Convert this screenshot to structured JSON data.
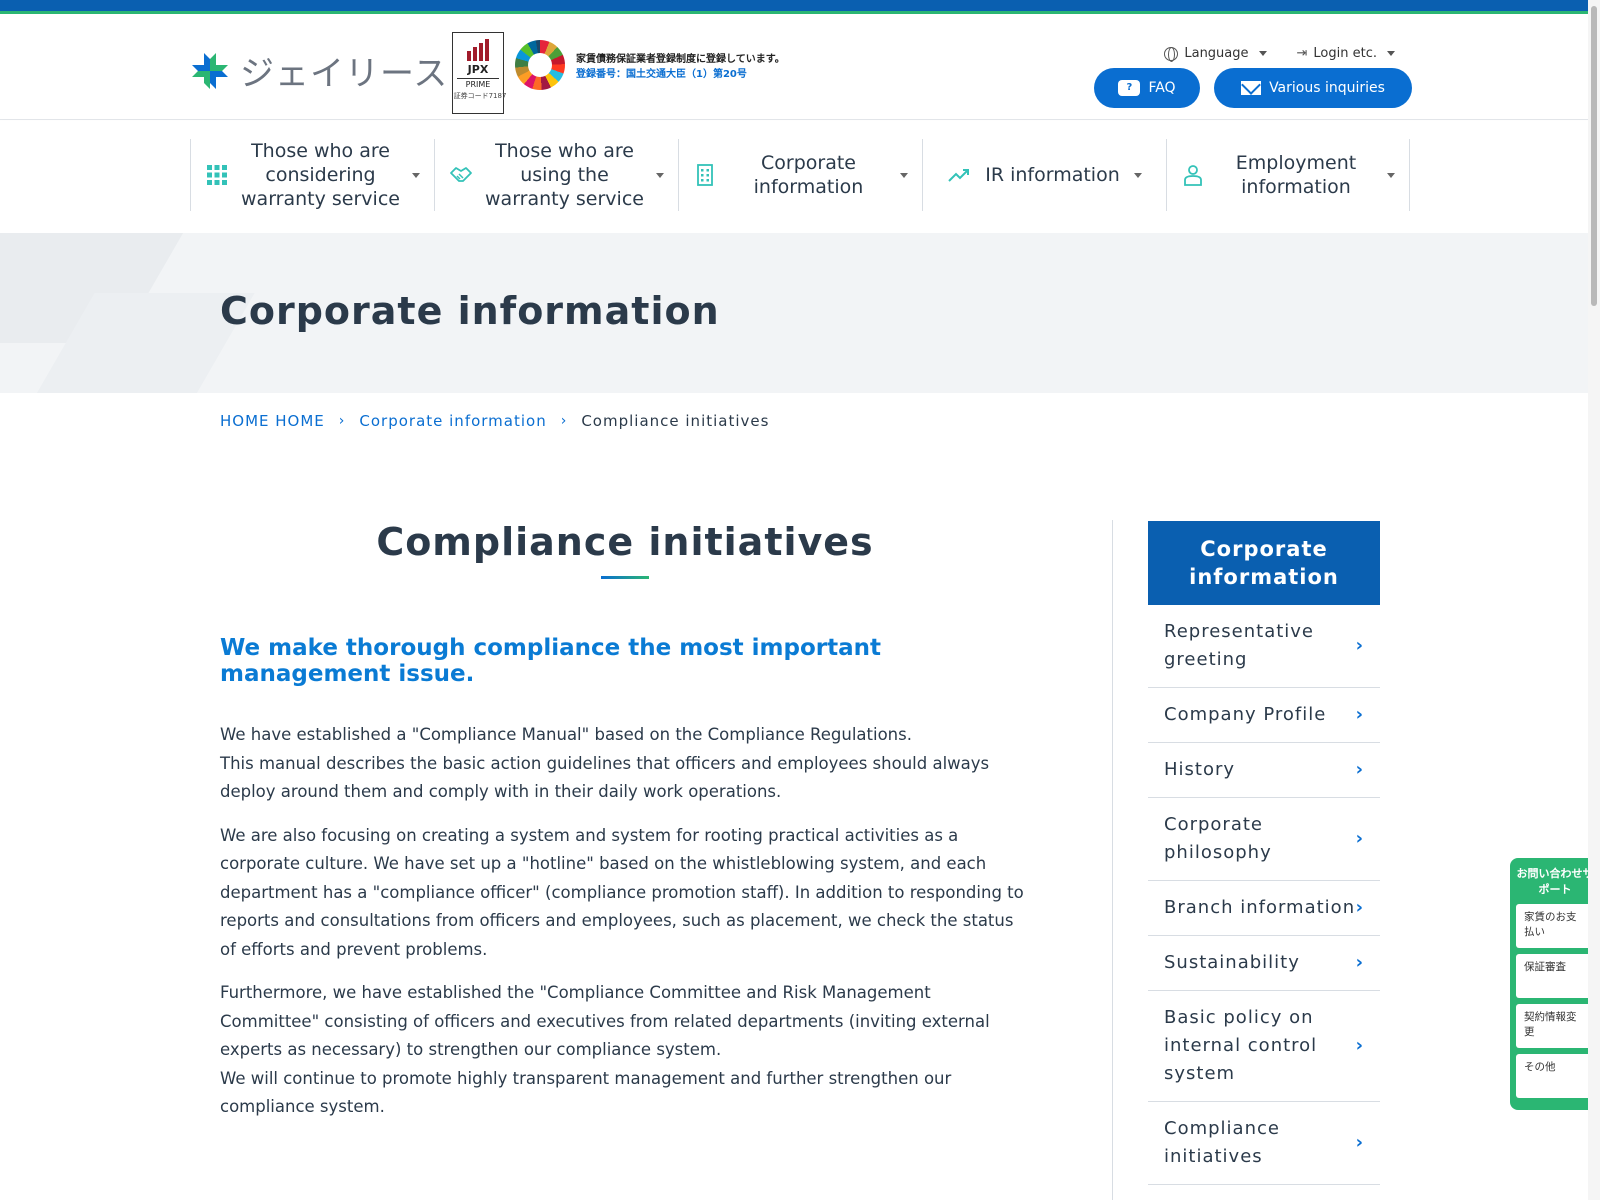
{
  "header": {
    "logo_text": "ジェイリース",
    "jpx": {
      "label": "JPX",
      "market": "PRIME",
      "code": "証券コード7187"
    },
    "registration_line1": "家賃債務保証業者登録制度に登録しています。",
    "registration_line2": "登録番号：国土交通大臣（1）第20号",
    "language_label": "Language",
    "login_label": "Login etc.",
    "faq_label": "FAQ",
    "inquiries_label": "Various inquiries"
  },
  "nav": {
    "items": [
      {
        "label": "Those who are considering warranty service",
        "icon": "grid-dots-icon"
      },
      {
        "label": "Those who are using the warranty service",
        "icon": "handshake-icon"
      },
      {
        "label": "Corporate information",
        "icon": "building-icon"
      },
      {
        "label": "IR information",
        "icon": "trend-up-icon"
      },
      {
        "label": "Employment information",
        "icon": "person-icon"
      }
    ]
  },
  "hero": {
    "title": "Corporate information"
  },
  "breadcrumb": {
    "home": "HOME HOME",
    "parent": "Corporate information",
    "current": "Compliance initiatives"
  },
  "main": {
    "heading": "Compliance initiatives",
    "lead": "We make thorough compliance the most important management issue.",
    "paragraphs": [
      "We have established a \"Compliance Manual\" based on the Compliance Regulations.",
      "This manual describes the basic action guidelines that officers and employees should always deploy around them and comply with in their daily work operations.",
      "We are also focusing on creating a system and system for rooting practical activities as a corporate culture. We have set up a \"hotline\" based on the whistleblowing system, and each department has a \"compliance officer\" (compliance promotion staff). In addition to responding to reports and consultations from officers and employees, such as placement, we check the status of efforts and prevent problems.",
      "Furthermore, we have established the \"Compliance Committee and Risk Management Committee\" consisting of officers and executives from related departments (inviting external experts as necessary) to strengthen our compliance system.",
      "We will continue to promote highly transparent management and further strengthen our compliance system."
    ]
  },
  "sidebar": {
    "title": "Corporate information",
    "items": [
      {
        "label": "Representative greeting"
      },
      {
        "label": "Company Profile"
      },
      {
        "label": "History"
      },
      {
        "label": "Corporate philosophy"
      },
      {
        "label": "Branch information"
      },
      {
        "label": "Sustainability"
      },
      {
        "label": "Basic policy on internal control system"
      },
      {
        "label": "Compliance initiatives"
      }
    ]
  },
  "support": {
    "title": "お問い合わせサポート",
    "buttons": [
      "家賃のお支払い",
      "保証審査",
      "契約情報変更",
      "その他"
    ]
  },
  "colors": {
    "brand_blue": "#0a6ed1",
    "nav_dark_blue": "#0a5fb0",
    "accent_green": "#2bb673",
    "nav_icon_teal": "#33c2b8"
  }
}
